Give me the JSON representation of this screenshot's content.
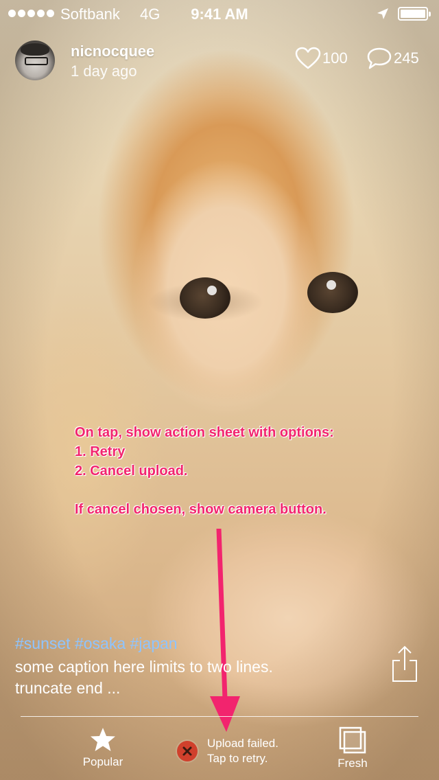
{
  "status_bar": {
    "carrier": "Softbank",
    "network": "4G",
    "time": "9:41 AM",
    "signal_icon": "signal-dots-icon",
    "location_icon": "location-arrow-icon",
    "battery_icon": "battery-full-icon"
  },
  "post": {
    "username": "nicnocquee",
    "time_ago": "1 day ago",
    "likes": "100",
    "comments": "245",
    "hashtags": "#sunset #osaka #japan",
    "caption_line1": "some caption here limits to two lines.",
    "caption_line2": "truncate end ...",
    "like_icon": "heart-icon",
    "comment_icon": "speech-bubble-icon",
    "share_icon": "share-icon"
  },
  "annotation": {
    "line1": "On tap, show action sheet with options:",
    "line2": "1. Retry",
    "line3": "2. Cancel upload.",
    "line4": "If cancel chosen, show camera button.",
    "color": "#f2246e"
  },
  "tab_bar": {
    "popular_label": "Popular",
    "popular_icon": "star-icon",
    "fresh_label": "Fresh",
    "fresh_icon": "stacked-squares-icon",
    "upload_failed_line1": "Upload failed.",
    "upload_failed_line2": "Tap to retry.",
    "upload_error_icon": "error-x-icon",
    "error_color": "#d0402c"
  },
  "colors": {
    "hashtag": "#8ec4ff",
    "text": "#ffffff"
  }
}
